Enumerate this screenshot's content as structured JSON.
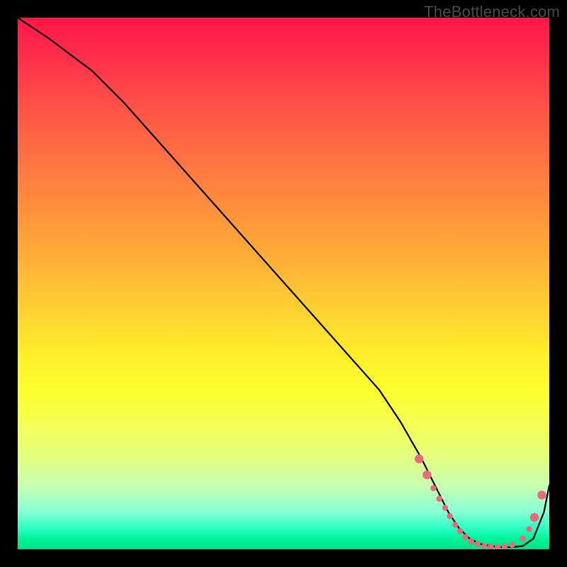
{
  "watermark": "TheBottleneck.com",
  "chart_data": {
    "type": "line",
    "title": "",
    "xlabel": "",
    "ylabel": "",
    "xlim": [
      0,
      100
    ],
    "ylim": [
      0,
      100
    ],
    "series": [
      {
        "name": "curve",
        "x": [
          0,
          3,
          6,
          10,
          14,
          20,
          28,
          36,
          44,
          52,
          60,
          68,
          72,
          76,
          79,
          81,
          83,
          85,
          87,
          89,
          91,
          93,
          95,
          97,
          99,
          100
        ],
        "y": [
          100,
          98,
          96,
          93,
          90,
          84,
          75,
          66,
          57,
          48,
          39,
          30,
          24,
          17,
          11,
          7,
          4,
          2,
          1,
          0.6,
          0.4,
          0.4,
          0.6,
          2,
          7,
          12
        ]
      }
    ],
    "dots": {
      "color": "#e96a7a",
      "radius_small": 4.2,
      "radius_large": 6.2,
      "points": [
        {
          "x": 75.5,
          "y": 17,
          "r": "large"
        },
        {
          "x": 77.0,
          "y": 14,
          "r": "large"
        },
        {
          "x": 78.2,
          "y": 11.5,
          "r": "small"
        },
        {
          "x": 79.3,
          "y": 9.5,
          "r": "small"
        },
        {
          "x": 80.4,
          "y": 7.8,
          "r": "small"
        },
        {
          "x": 81.3,
          "y": 6.2,
          "r": "small"
        },
        {
          "x": 82.3,
          "y": 4.6,
          "r": "small"
        },
        {
          "x": 83.2,
          "y": 3.4,
          "r": "small"
        },
        {
          "x": 84.2,
          "y": 2.3,
          "r": "small"
        },
        {
          "x": 85.3,
          "y": 1.5,
          "r": "small"
        },
        {
          "x": 86.5,
          "y": 1.0,
          "r": "small"
        },
        {
          "x": 87.8,
          "y": 0.6,
          "r": "small"
        },
        {
          "x": 89.0,
          "y": 0.5,
          "r": "small"
        },
        {
          "x": 90.3,
          "y": 0.4,
          "r": "small"
        },
        {
          "x": 91.6,
          "y": 0.5,
          "r": "small"
        },
        {
          "x": 93.0,
          "y": 0.8,
          "r": "small"
        },
        {
          "x": 95.0,
          "y": 2.0,
          "r": "small"
        },
        {
          "x": 96.2,
          "y": 3.8,
          "r": "small"
        },
        {
          "x": 97.2,
          "y": 6.0,
          "r": "large"
        },
        {
          "x": 98.6,
          "y": 10.2,
          "r": "large"
        }
      ]
    }
  }
}
